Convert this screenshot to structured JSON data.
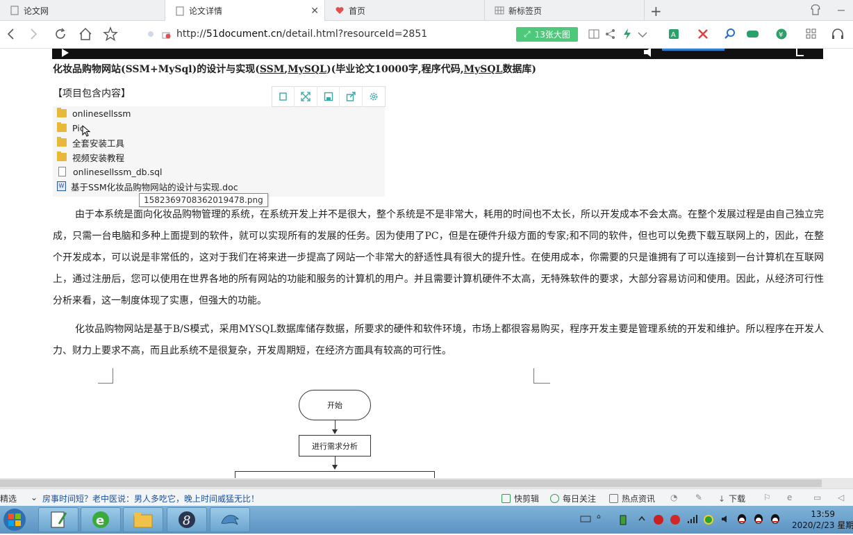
{
  "tabs": [
    {
      "label": "论文网",
      "active": false
    },
    {
      "label": "论文详情",
      "active": true
    },
    {
      "label": "首页",
      "active": false
    },
    {
      "label": "新标签页",
      "active": false
    }
  ],
  "address": {
    "url_prefix": "http://",
    "url_host": "51document.cn",
    "url_path": "/detail.html?resourceId=2851",
    "images_button": "13张大图"
  },
  "article": {
    "title_parts": [
      "化妆品购物网站(SSM+MySql)的设计与实现(",
      "SSM",
      ",",
      "MySQL",
      ")(毕业论文10000字,程序代码,",
      "MySQL",
      "数据库)"
    ],
    "section_head": "【项目包含内容】",
    "files": [
      {
        "name": "onlinesellssm",
        "type": "folder"
      },
      {
        "name": "Pic",
        "type": "folder"
      },
      {
        "name": "全套安装工具",
        "type": "folder"
      },
      {
        "name": "视频安装教程",
        "type": "folder"
      },
      {
        "name": "onlinesellssm_db.sql",
        "type": "sql"
      },
      {
        "name": "基于SSM化妆品购物网站的设计与实现.doc",
        "type": "doc"
      }
    ],
    "tooltip": "1582369708362019478.png",
    "para1": "由于本系统是面向化妆品购物管理的系统，在系统开发上并不是很大，整个系统是不是非常大，耗用的时间也不太长，所以开发成本不会太高。在整个发展过程是由自己独立完成，只需一台电脑和多种上面提到的软件，就可以实现所有的发展的任务。因为使用了PC，但是在硬件升级方面的专家;和不同的软件，但也可以免费下载互联网上的，因此，在整个开发成本，可以说是非常低的，这对于我们在将来进一步提高了网站一个非常大的舒适性具有很大的提升性。在使用成本，你需要的只是谁拥有了可以连接到一台计算机在互联网上，通过注册后，您可以使用在世界各地的所有网站的功能和服务的计算机的用户。并且需要计算机硬件不太高，无特殊软件的要求，大部分容易访问和使用。因此，从经济可行性分析来看，这一制度体现了实惠，但强大的功能。",
    "para2": "化妆品购物网站是基于B/S模式，采用MYSQL数据库储存数据，所要求的硬件和软件环境，市场上都很容易购买，程序开发主要是管理系统的开发和维护。所以程序在开发人力、财力上要求不高，而且此系统不是很复杂，开发周期短，在经济方面具有较高的可行性。",
    "flow_start": "开始",
    "flow_step1": "进行需求分析"
  },
  "statusbar": {
    "left_fragment": "精选",
    "news": "房事时间短？老中医说：男人多吃它，晚上时间威猛无比！",
    "items": [
      "快剪辑",
      "每日关注",
      "热点资讯",
      "下载"
    ]
  },
  "taskbar": {
    "time": "13:59",
    "date": "2020/2/23 星期"
  },
  "colors": {
    "accent_green": "#4ec97b",
    "taskbar_blue": "#6aa5cf"
  }
}
